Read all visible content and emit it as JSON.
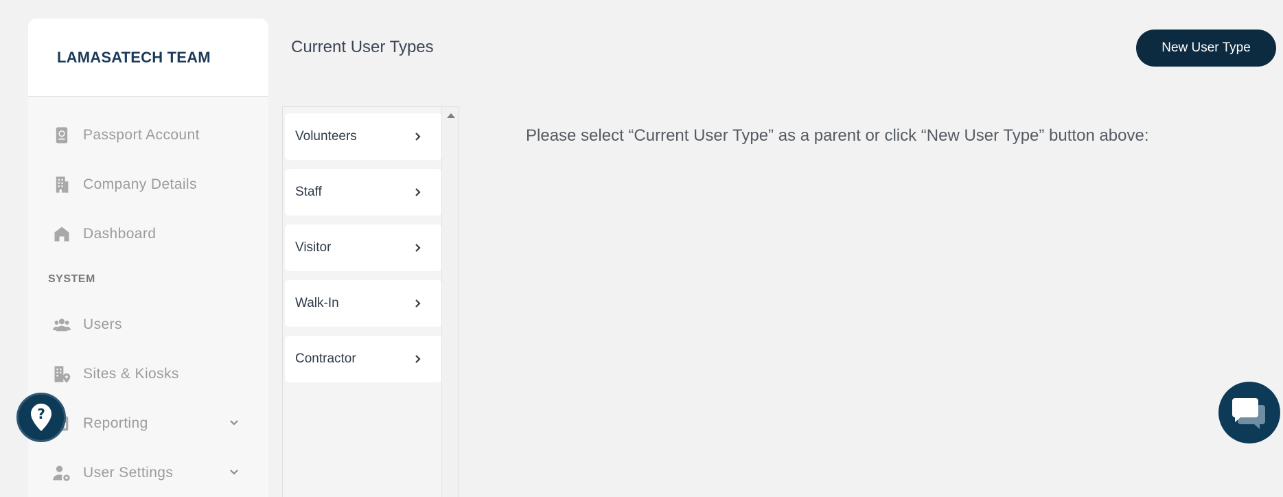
{
  "sidebar": {
    "team_name": "LAMASATECH TEAM",
    "items_top": [
      {
        "label": "Passport Account",
        "icon": "passport-icon"
      },
      {
        "label": "Company Details",
        "icon": "building-icon"
      },
      {
        "label": "Dashboard",
        "icon": "home-icon"
      }
    ],
    "section_title": "SYSTEM",
    "items_system": [
      {
        "label": "Users",
        "icon": "users-icon"
      },
      {
        "label": "Sites & Kiosks",
        "icon": "site-location-icon"
      },
      {
        "label": "Reporting",
        "icon": "report-icon",
        "has_chevron": true
      },
      {
        "label": "User Settings",
        "icon": "user-settings-icon",
        "has_chevron": true
      }
    ]
  },
  "main": {
    "title": "Current User Types",
    "new_button_label": "New User Type",
    "instruction": "Please select “Current User Type” as a parent or click “New User Type” button above:",
    "user_types": [
      "Volunteers",
      "Staff",
      "Visitor",
      "Walk-In",
      "Contractor"
    ]
  },
  "colors": {
    "accent_dark": "#0d2b40",
    "background": "#f2f2f2",
    "sidebar_text": "#9b9b9b",
    "team_name": "#1b3a5a"
  }
}
